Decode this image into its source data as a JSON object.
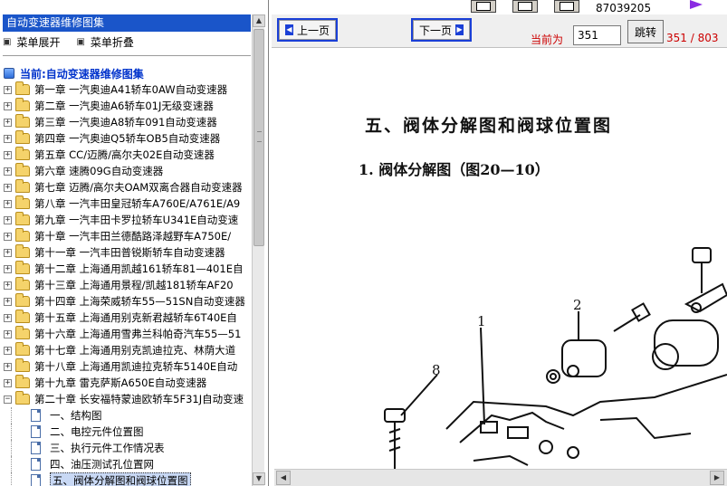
{
  "sidebar": {
    "title": "自动变速器维修图集",
    "menu": {
      "expand_label": "菜单展开",
      "collapse_label": "菜单折叠"
    },
    "current_label": "当前:自动变速器维修图集",
    "chapters": [
      {
        "num": "第一章",
        "name": "一汽奥迪A41轿车0AW自动变速器"
      },
      {
        "num": "第二章",
        "name": "一汽奥迪A6轿车01J无级变速器"
      },
      {
        "num": "第三章",
        "name": "一汽奥迪A8轿车091自动变速器"
      },
      {
        "num": "第四章",
        "name": "一汽奥迪Q5轿车OB5自动变速器"
      },
      {
        "num": "第五章",
        "name": "CC/迈腾/高尔夫02E自动变速器"
      },
      {
        "num": "第六章",
        "name": "速腾09G自动变速器"
      },
      {
        "num": "第七章",
        "name": "迈腾/高尔夫OAM双离合器自动变速器"
      },
      {
        "num": "第八章",
        "name": "一汽丰田皇冠轿车A760E/A761E/A9"
      },
      {
        "num": "第九章",
        "name": "一汽丰田卡罗拉轿车U341E自动变速"
      },
      {
        "num": "第十章",
        "name": "一汽丰田兰德酷路泽越野车A750E/"
      },
      {
        "num": "第十一章",
        "name": "一汽丰田普锐斯轿车自动变速器"
      },
      {
        "num": "第十二章",
        "name": "上海通用凯越161轿车81—401E自"
      },
      {
        "num": "第十三章",
        "name": "上海通用景程/凯越181轿车AF20"
      },
      {
        "num": "第十四章",
        "name": "上海荣威轿车55—51SN自动变速器"
      },
      {
        "num": "第十五章",
        "name": "上海通用别克新君越轿车6T40E自"
      },
      {
        "num": "第十六章",
        "name": "上海通用雪弗兰科帕奇汽车55—51"
      },
      {
        "num": "第十七章",
        "name": "上海通用别克凯迪拉克、林荫大道"
      },
      {
        "num": "第十八章",
        "name": "上海通用凯迪拉克轿车5140E自动"
      },
      {
        "num": "第十九章",
        "name": "雷克萨斯A650E自动变速器"
      },
      {
        "num": "第二十章",
        "name": "长安福特蒙迪欧轿车5F31J自动变速"
      }
    ],
    "subitems": [
      "一、结构图",
      "二、电控元件位置图",
      "三、执行元件工作情况表",
      "四、油压测试孔位置网",
      "五、阀体分解图和阀球位置图"
    ]
  },
  "topstrip": {
    "phone": "87039205"
  },
  "navbar": {
    "prev_label": "上一页",
    "next_label": "下一页",
    "current_label": "当前为",
    "page_value": "351",
    "jump_label": "跳转",
    "page_count": "351 / 803"
  },
  "doc": {
    "heading": "五、阀体分解图和阀球位置图",
    "subheading": "1. 阀体分解图（图20—10）",
    "callouts": [
      "1",
      "2",
      "8"
    ]
  },
  "colors": {
    "title_bar": "#1a55c9",
    "nav_border": "#1a3fd6",
    "page_red": "#cc0000",
    "current_blue": "#0033cc"
  }
}
